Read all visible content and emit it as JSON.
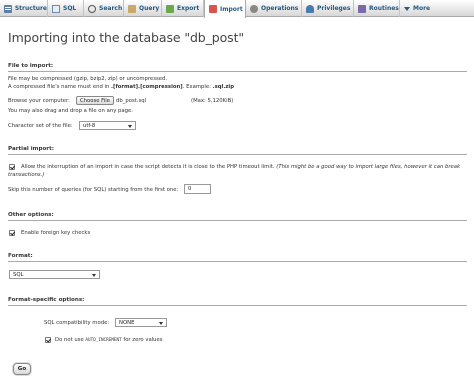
{
  "tabs": [
    {
      "label": "Structure",
      "icon": "structure-icon"
    },
    {
      "label": "SQL",
      "icon": "sql-icon"
    },
    {
      "label": "Search",
      "icon": "search-icon"
    },
    {
      "label": "Query",
      "icon": "query-icon"
    },
    {
      "label": "Export",
      "icon": "export-icon"
    },
    {
      "label": "Import",
      "icon": "import-icon",
      "active": true
    },
    {
      "label": "Operations",
      "icon": "operations-icon"
    },
    {
      "label": "Privileges",
      "icon": "privileges-icon"
    },
    {
      "label": "Routines",
      "icon": "routines-icon"
    },
    {
      "label": "More",
      "icon": "chevron-down-icon"
    }
  ],
  "page_title": "Importing into the database \"db_post\"",
  "file_to_import": {
    "legend": "File to import:",
    "line1": "File may be compressed (gzip, bzip2, zip) or uncompressed.",
    "line2_prefix": "A compressed file's name must end in ",
    "line2_format": ".[format].[compression]",
    "line2_mid": ". Example: ",
    "line2_example": ".sql.zip",
    "browse_label": "Browse your computer:",
    "choose_file_button": "Choose File",
    "chosen_file": "db_post.sql",
    "max_size": "(Max: 5,120KiB)",
    "drag_hint": "You may also drag and drop a file on any page.",
    "charset_label": "Character set of the file:",
    "charset_value": "utf-8"
  },
  "partial_import": {
    "legend": "Partial import:",
    "allow_interrupt_text": "Allow the interruption of an import in case the script detects it is close to the PHP timeout limit.",
    "allow_interrupt_note": " (This might be a good way to import large files, however it can break",
    "allow_interrupt_note2": "transactions.)",
    "allow_interrupt_checked": true,
    "skip_label": "Skip this number of queries (for SQL) starting from the first one:",
    "skip_value": "0"
  },
  "other_options": {
    "legend": "Other options:",
    "foreign_key_label": "Enable foreign key checks",
    "foreign_key_checked": true
  },
  "format": {
    "legend": "Format:",
    "value": "SQL"
  },
  "format_specific": {
    "legend": "Format-specific options:",
    "compat_label": "SQL compatibility mode:",
    "compat_value": "NONE",
    "auto_inc_prefix": "Do not use ",
    "auto_inc_code": "AUTO_INCREMENT",
    "auto_inc_suffix": " for zero values",
    "auto_inc_checked": true
  },
  "go_button": "Go",
  "colors": {
    "tab_text": "#235a81",
    "heading": "#444444"
  }
}
